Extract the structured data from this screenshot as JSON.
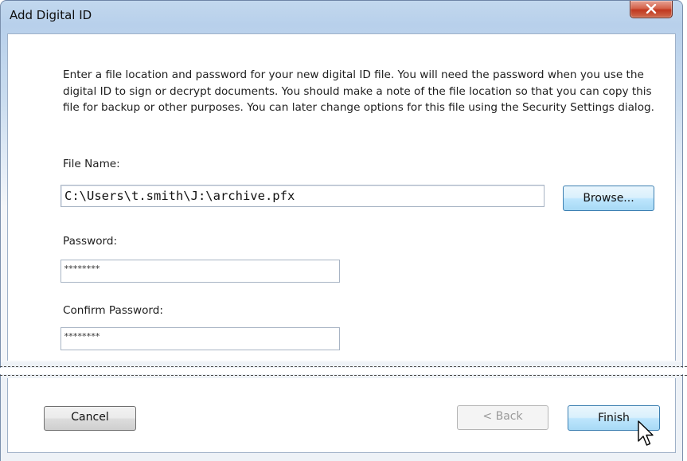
{
  "window": {
    "title": "Add Digital ID",
    "close_icon": "close-x-icon"
  },
  "instructions": "Enter a file location and password for your new digital ID file. You will need the password when you use the digital ID to sign or decrypt documents. You should make a note of the file location so that you can copy this file for backup or other purposes. You can later change options for this file using the Security Settings dialog.",
  "file_name": {
    "label": "File Name:",
    "value": "C:\\Users\\t.smith\\J:\\archive.pfx",
    "browse_label": "Browse..."
  },
  "password": {
    "label": "Password:",
    "value": "********"
  },
  "confirm_password": {
    "label": "Confirm Password:",
    "value": "********"
  },
  "footer": {
    "cancel_label": "Cancel",
    "back_label": "< Back",
    "finish_label": "Finish"
  },
  "colors": {
    "frame": "#b8d0eb",
    "close_button": "#c7472d",
    "focus_border": "#3c7fb1"
  }
}
